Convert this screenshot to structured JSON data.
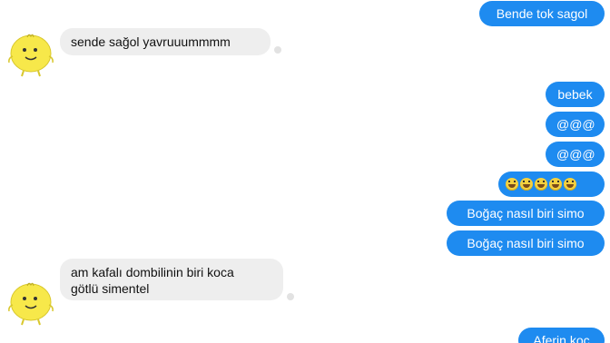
{
  "conversation": {
    "messages": [
      {
        "side": "out",
        "text": "Bende tok sagol"
      },
      {
        "side": "in",
        "text": "sende sağol yavruuummmm",
        "avatar": "simsimi-yellow-avatar"
      },
      {
        "side": "out",
        "text": "bebek"
      },
      {
        "side": "out",
        "text": "@@@"
      },
      {
        "side": "out",
        "text": "@@@"
      },
      {
        "side": "out",
        "text": "😂😂😂😂😂",
        "type": "emoji"
      },
      {
        "side": "out",
        "text": "Boğaç nasıl biri simo"
      },
      {
        "side": "out",
        "text": "Boğaç nasıl biri simo"
      },
      {
        "side": "in",
        "text": "am kafalı dombilinin biri koca\ngötlü simentel",
        "avatar": "simsimi-yellow-avatar"
      },
      {
        "side": "out",
        "text": "Aferin koç"
      }
    ]
  },
  "colors": {
    "outgoing_bubble": "#1e8bf0",
    "incoming_bubble": "#eeeeee",
    "avatar": "#f7e84a"
  }
}
